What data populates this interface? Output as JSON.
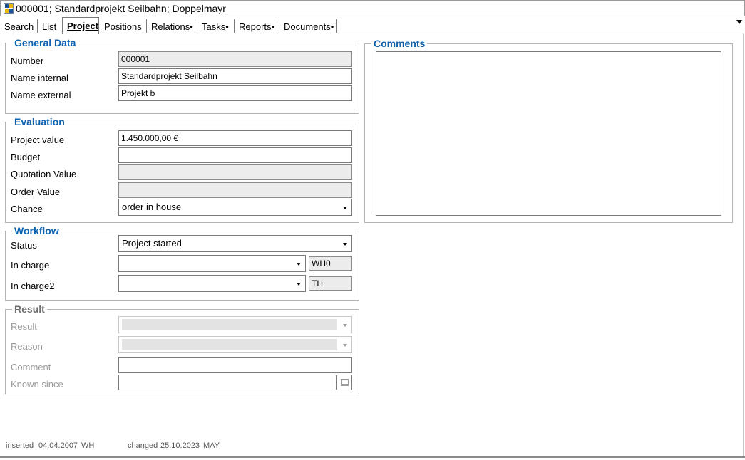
{
  "window": {
    "title": "000001; Standardprojekt Seilbahn; Doppelmayr"
  },
  "tabs": [
    {
      "label": "Search"
    },
    {
      "label": "List"
    },
    {
      "label": "Project"
    },
    {
      "label": "Positions"
    },
    {
      "label": "Relations•"
    },
    {
      "label": "Tasks•"
    },
    {
      "label": "Reports•"
    },
    {
      "label": "Documents•"
    }
  ],
  "active_tab": "Project",
  "general": {
    "title": "General Data",
    "number_label": "Number",
    "number_value": "000001",
    "name_internal_label": "Name internal",
    "name_internal_value": "Standardprojekt Seilbahn",
    "name_external_label": "Name external",
    "name_external_value": "Projekt b"
  },
  "evaluation": {
    "title": "Evaluation",
    "project_value_label": "Project value",
    "project_value": "1.450.000,00 €",
    "budget_label": "Budget",
    "budget_value": "",
    "quotation_label": "Quotation Value",
    "quotation_value": "",
    "order_label": "Order Value",
    "order_value": "",
    "chance_label": "Chance",
    "chance_value": "order in house"
  },
  "workflow": {
    "title": "Workflow",
    "status_label": "Status",
    "status_value": "Project started",
    "in_charge_label": "In charge",
    "in_charge_value": "",
    "in_charge_code": "WH0",
    "in_charge2_label": "In charge2",
    "in_charge2_value": "",
    "in_charge2_code": "TH"
  },
  "result": {
    "title": "Result",
    "result_label": "Result",
    "reason_label": "Reason",
    "comment_label": "Comment",
    "comment_value": "",
    "known_since_label": "Known since",
    "known_since_value": ""
  },
  "comments": {
    "title": "Comments",
    "text": ""
  },
  "footer": {
    "inserted_label": "inserted",
    "inserted_date": "04.04.2007",
    "inserted_by": "WH",
    "changed_label": "changed",
    "changed_date": "25.10.2023",
    "changed_by": "MAY"
  },
  "colors": {
    "group_title": "#0e63b0",
    "readonly_bg": "#ececec"
  }
}
